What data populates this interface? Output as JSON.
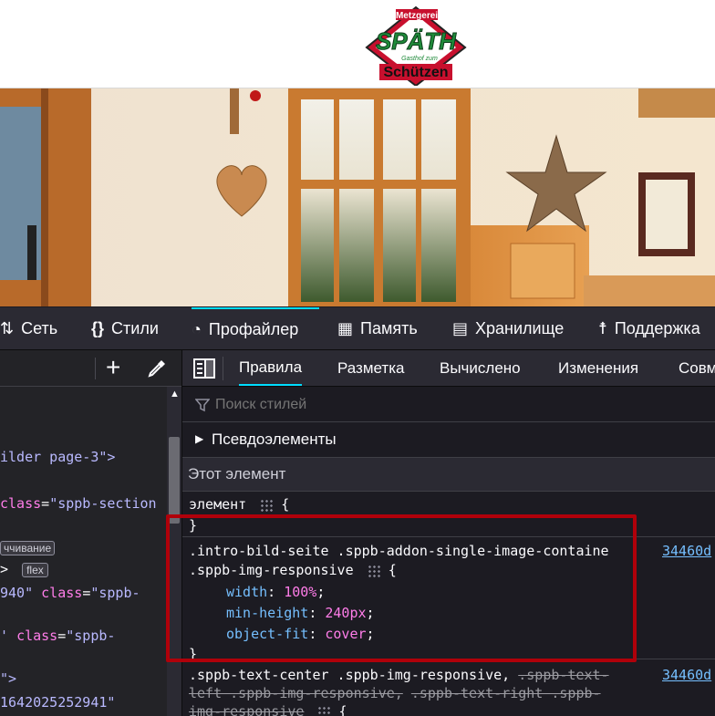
{
  "site": {
    "logo": {
      "line1": "Metzgerei",
      "line2": "SPÄTH",
      "line3": "Gasthof zum",
      "line4": "Schützen"
    }
  },
  "devtools": {
    "tools": [
      {
        "label": "Сеть",
        "icon": "network-icon"
      },
      {
        "label": "Стили",
        "icon": "braces-icon"
      },
      {
        "label": "Профайлер",
        "icon": "gauge-icon",
        "active": true
      },
      {
        "label": "Память",
        "icon": "chip-icon"
      },
      {
        "label": "Хранилище",
        "icon": "storage-icon"
      },
      {
        "label": "Поддержка",
        "icon": "accessibility-icon"
      }
    ],
    "subtabs": [
      "Правила",
      "Разметка",
      "Вычислено",
      "Изменения",
      "Совм"
    ],
    "filter_placeholder": "Поиск стилей",
    "pseudo_label": "Псевдоэлементы",
    "this_element_label": "Этот элемент",
    "left_code": {
      "line1": "ilder page-3\">",
      "line2_attr": "class",
      "line2_val": "\"sppb-section",
      "badge_scroll": "ччивание",
      "badge_flex": "flex",
      "line4_num": "940\"",
      "line4_attr": "class",
      "line4_val": "\"sppb-",
      "line5_pre": "'",
      "line5_attr": "class",
      "line5_val": "\"sppb-",
      "line6": "\">",
      "line7": "1642025252941\""
    },
    "rules": {
      "element_selector": "элемент",
      "open_brace": "{",
      "close_brace": "}",
      "rule1_selector_a": ".intro-bild-seite .sppb-addon-single-image-containe",
      "rule1_selector_b": ".sppb-img-responsive",
      "rule1_source": "34460d",
      "rule1_props": [
        {
          "name": "width",
          "value": "100%"
        },
        {
          "name": "min-height",
          "value": "240px"
        },
        {
          "name": "object-fit",
          "value": "cover"
        }
      ],
      "rule2_selector_a": ".sppb-text-center .sppb-img-responsive,",
      "rule2_selector_a_strike": ".sppb-text-",
      "rule2_selector_b_strike": "left .sppb-img-responsive,",
      "rule2_selector_b_strike2": ".sppb-text-right .sppb-",
      "rule2_selector_c_strike": "img-responsive",
      "rule2_source": "34460d"
    }
  }
}
